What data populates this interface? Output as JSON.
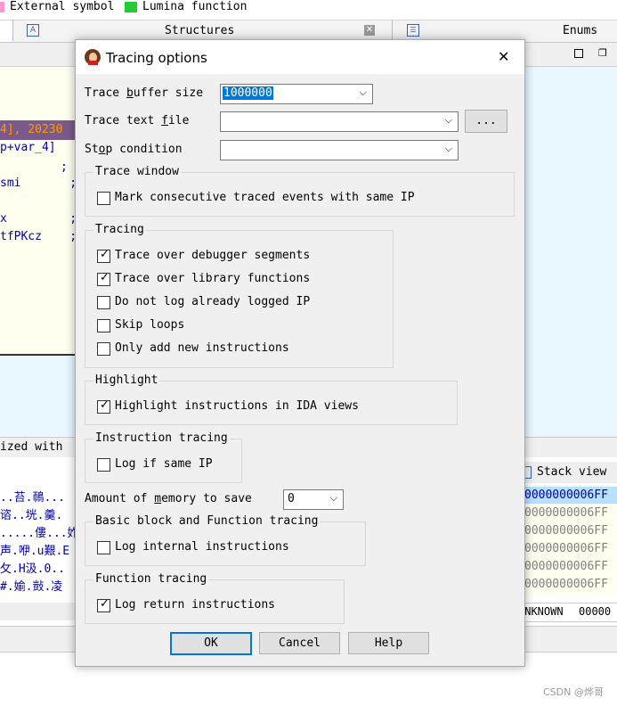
{
  "background": {
    "legend": [
      {
        "label": "External symbol",
        "color": "#ff9ad0"
      },
      {
        "label": "Lumina function",
        "color": "#22cc33"
      }
    ],
    "panes": {
      "structures_title": "Structures",
      "enums_title": "Enums",
      "output_text": "ized with",
      "stack_view_title": "Stack view",
      "stack_footer_left": "UNKNOWN",
      "stack_footer_right": "00000"
    },
    "disasm_lines": [
      "4], 20230",
      "p+var_4]",
      ";",
      "smi       ;",
      "x         ;",
      "tfPKcz    ;"
    ],
    "hex_lines": [
      "..苔.鳾...",
      "谘..垙.羹.",
      ".....僂...妰",
      "声.咿.u艱.E",
      "攵.H汲.0..",
      "#.媮.敱.凌"
    ],
    "stack_lines": [
      "0000000006FF",
      "0000000006FF",
      "0000000006FF",
      "0000000006FF",
      "0000000006FF",
      "0000000006FF"
    ],
    "watermark": "CSDN @烨哥"
  },
  "dialog": {
    "title": "Tracing options",
    "close_glyph": "✕",
    "buffer_size": {
      "label_pre": "Trace ",
      "label_ul": "b",
      "label_post": "uffer size",
      "value": "1000000"
    },
    "text_file": {
      "label_pre": "Trace text ",
      "label_ul": "f",
      "label_post": "ile",
      "value": "",
      "browse_label": "..."
    },
    "stop_condition": {
      "label_pre": "St",
      "label_ul": "o",
      "label_post": "p condition",
      "value": ""
    },
    "trace_window": {
      "title": "Trace window",
      "items": [
        {
          "label": "Mark consecutive traced events with same IP",
          "checked": false
        }
      ]
    },
    "tracing": {
      "title": "Tracing",
      "items": [
        {
          "label": "Trace over debugger segments",
          "checked": true
        },
        {
          "label": "Trace over library functions",
          "checked": true
        },
        {
          "label": "Do not log already logged IP",
          "checked": false
        },
        {
          "label": "Skip loops",
          "checked": false
        },
        {
          "label": "Only add new instructions",
          "checked": false
        }
      ]
    },
    "highlight": {
      "title": "Highlight",
      "items": [
        {
          "label": "Highlight instructions in IDA views",
          "checked": true
        }
      ]
    },
    "instruction_tracing": {
      "title": "Instruction tracing",
      "items": [
        {
          "label": "Log if same IP",
          "checked": false
        }
      ]
    },
    "memory": {
      "label_pre": "Amount of ",
      "label_ul": "m",
      "label_post": "emory to save",
      "value": "0"
    },
    "basic_block": {
      "title": "Basic block and Function tracing",
      "items": [
        {
          "label": "Log internal instructions",
          "checked": false
        }
      ]
    },
    "function_tracing": {
      "title": "Function tracing",
      "items": [
        {
          "label": "Log return instructions",
          "checked": true
        }
      ]
    },
    "buttons": {
      "ok": "OK",
      "cancel": "Cancel",
      "help": "Help"
    },
    "check_glyph": "✓"
  }
}
